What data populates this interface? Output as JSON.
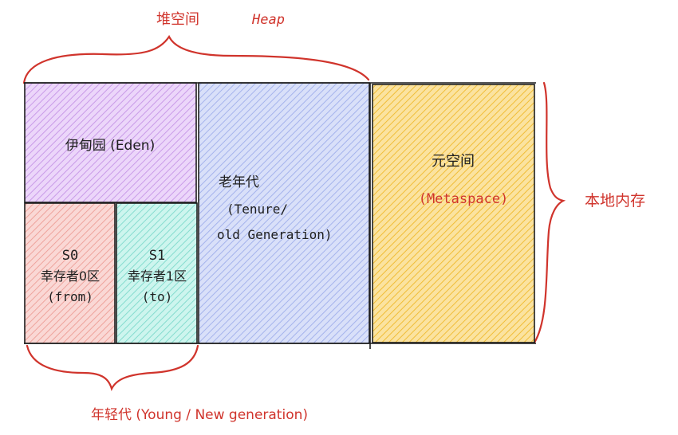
{
  "colors": {
    "brace_red": "#d0342c",
    "outline": "#1e1e1e",
    "eden_fill": "#e3c1f7",
    "s0_fill": "#f7c4c0",
    "s1_fill": "#b6efe6",
    "old_fill": "#c3cdf5",
    "meta_fill": "#f8d66f"
  },
  "heap": {
    "cn": "堆空间",
    "en": "Heap"
  },
  "native": {
    "label": "本地内存"
  },
  "young": {
    "label": "年轻代 (Young / New generation)"
  },
  "regions": {
    "eden": {
      "label": "伊甸园 (Eden)"
    },
    "s0": {
      "line1": "S0",
      "line2": "幸存者0区",
      "line3": "(from)"
    },
    "s1": {
      "line1": "S1",
      "line2": "幸存者1区",
      "line3": "(to)"
    },
    "old": {
      "line1": "老年代",
      "line2": "(Tenure/",
      "line3": "old Generation)"
    },
    "meta": {
      "line1": "元空间",
      "line2": "(Metaspace)"
    }
  }
}
